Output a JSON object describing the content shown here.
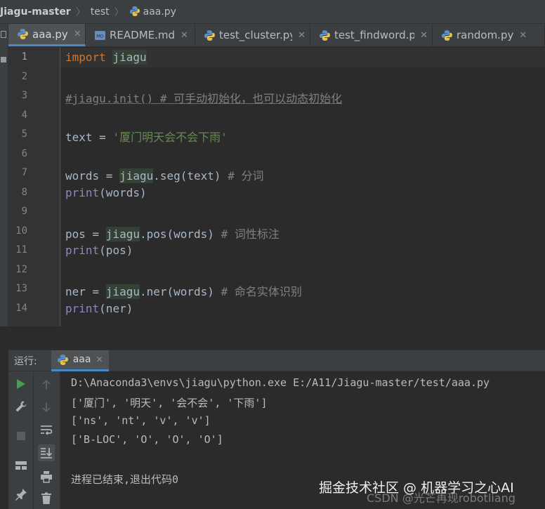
{
  "breadcrumb": {
    "project": "Jiagu-master",
    "folder": "test",
    "file": "aaa.py"
  },
  "tabs": [
    {
      "label": "aaa.py",
      "icon": "python-icon",
      "active": true
    },
    {
      "label": "README.md",
      "icon": "markdown-icon",
      "active": false
    },
    {
      "label": "test_cluster.py",
      "icon": "python-icon",
      "active": false
    },
    {
      "label": "test_findword.py",
      "icon": "python-icon",
      "active": false
    },
    {
      "label": "random.py",
      "icon": "python-icon",
      "active": false
    }
  ],
  "editor": {
    "line_numbers": [
      "1",
      "2",
      "3",
      "4",
      "5",
      "6",
      "7",
      "8",
      "9",
      "10",
      "11",
      "12",
      "13",
      "14"
    ],
    "code": {
      "l1_kw": "import",
      "l1_mod": "jiagu",
      "l3": "#jiagu.init() # 可手动初始化，也可以动态初始化",
      "l5_var": "text = ",
      "l5_str": "'厦门明天会不会下雨'",
      "l7_var": "words = ",
      "l7_mod": "jiagu",
      "l7_call": ".seg(text)",
      "l7_cmt": " # 分词",
      "l8_fn": "print",
      "l8_arg": "(words)",
      "l10_var": "pos = ",
      "l10_mod": "jiagu",
      "l10_call": ".pos(words)",
      "l10_cmt": " # 词性标注",
      "l11_fn": "print",
      "l11_arg": "(pos)",
      "l13_var": "ner = ",
      "l13_mod": "jiagu",
      "l13_call": ".ner(words)",
      "l13_cmt": " # 命名实体识别",
      "l14_fn": "print",
      "l14_arg": "(ner)"
    }
  },
  "run_panel": {
    "title": "运行:",
    "tab_label": "aaa",
    "toolbar_icons": [
      "run-icon",
      "wrench-icon",
      "stop-icon",
      "layout-icon",
      "pin-icon",
      "up-arrow-icon",
      "down-arrow-icon",
      "soft-wrap-icon",
      "scroll-to-end-icon",
      "print-icon",
      "trash-icon"
    ],
    "console": [
      "D:\\Anaconda3\\envs\\jiagu\\python.exe E:/A11/Jiagu-master/test/aaa.py",
      "['厦门', '明天', '会不会', '下雨']",
      "['ns', 'nt', 'v', 'v']",
      "['B-LOC', 'O', 'O', 'O']",
      "",
      "进程已结束,退出代码0"
    ]
  },
  "watermark": {
    "main": "掘金技术社区 @ 机器学习之心AI",
    "sub": "CSDN @光芒再现robotliang"
  },
  "colors": {
    "background": "#2b2b2b",
    "panel": "#3c3f41",
    "keyword": "#cc7832",
    "string": "#6a8759",
    "comment": "#808080",
    "builtin": "#8888c6",
    "accent": "#4a88c7",
    "run_green": "#499c54"
  }
}
